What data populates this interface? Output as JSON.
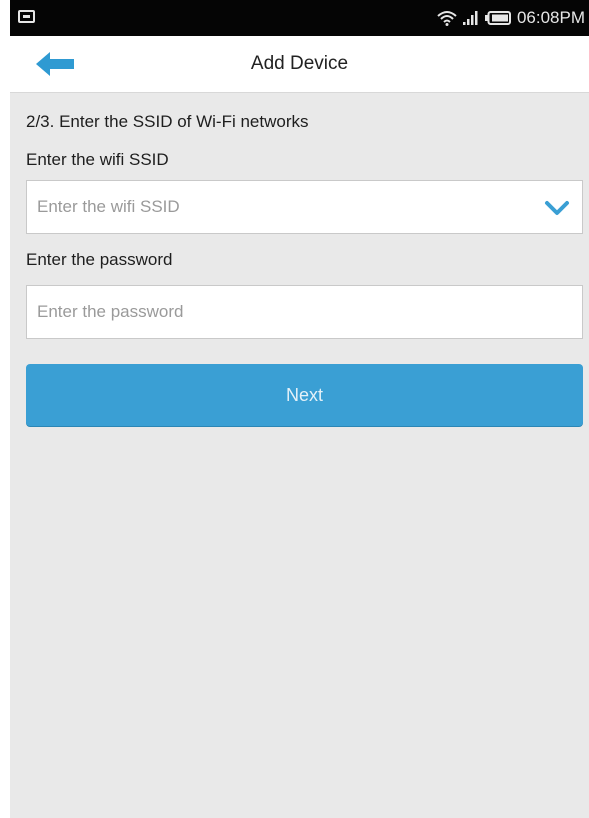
{
  "status_bar": {
    "time": "06:08PM",
    "left_icon": "screenshot-icon",
    "right_icons": [
      "wifi-icon",
      "signal-icon",
      "battery-icon"
    ]
  },
  "header": {
    "title": "Add Device",
    "back_icon": "back-arrow-icon"
  },
  "form": {
    "step_title": "2/3. Enter the SSID of Wi-Fi networks",
    "ssid_label": "Enter the wifi SSID",
    "ssid_placeholder": "Enter the wifi SSID",
    "ssid_value": "",
    "ssid_dropdown_icon": "chevron-down-icon",
    "password_label": "Enter the password",
    "password_placeholder": "Enter the password",
    "password_value": "",
    "next_label": "Next"
  },
  "colors": {
    "accent": "#3a9fd4",
    "background": "#e9e9e9",
    "status_bar": "#050505"
  }
}
